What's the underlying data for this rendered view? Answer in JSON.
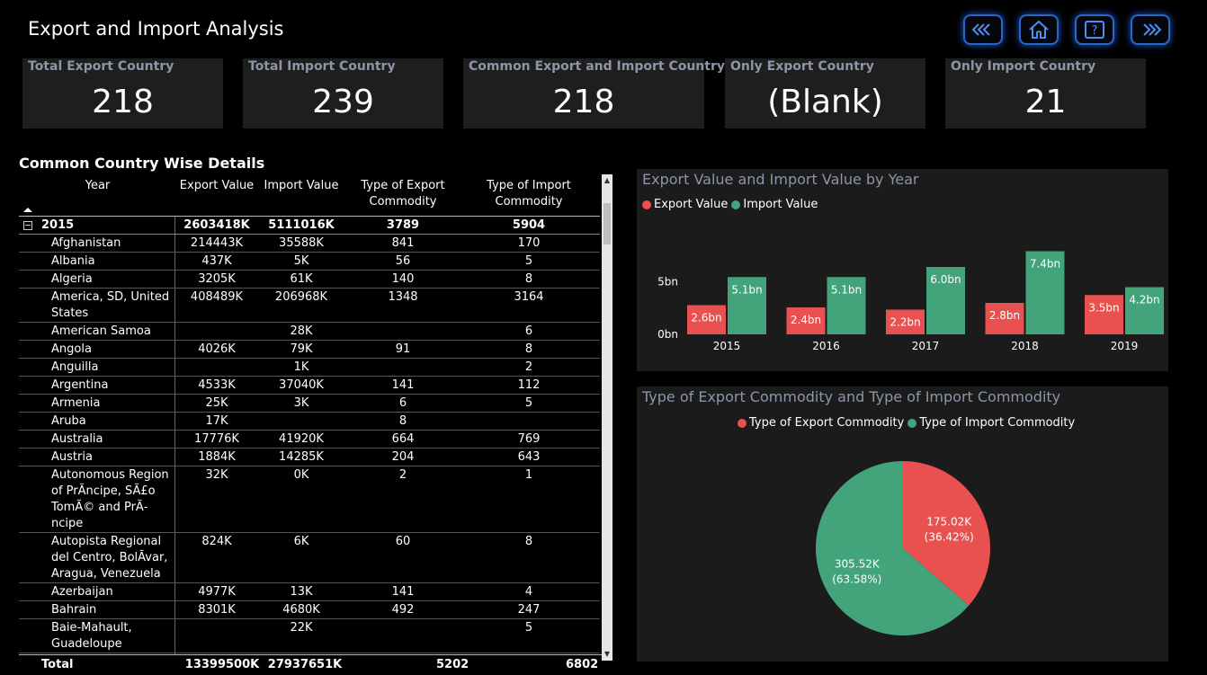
{
  "header": {
    "title": "Export and Import Analysis"
  },
  "nav": {
    "back_icon": "double-chevron-left-icon",
    "home_icon": "home-icon",
    "help_label": "?",
    "next_icon": "double-chevron-right-icon"
  },
  "kpis": [
    {
      "label": "Total Export Country",
      "value": "218"
    },
    {
      "label": "Total Import Country",
      "value": "239"
    },
    {
      "label": "Common Export and Import Country",
      "value": "218"
    },
    {
      "label": "Only Export Country",
      "value": "(Blank)"
    },
    {
      "label": "Only Import Country",
      "value": "21"
    }
  ],
  "table": {
    "title": "Common Country Wise Details",
    "columns": [
      "Year",
      "Export Value",
      "Import Value",
      "Type of Export Commodity",
      "Type of Import Commodity"
    ],
    "group": {
      "year": "2015",
      "export": "2603418K",
      "import": "5111016K",
      "type_export": "3789",
      "type_import": "5904"
    },
    "rows": [
      {
        "name": "Afghanistan",
        "export": "214443K",
        "import": "35588K",
        "type_export": "841",
        "type_import": "170"
      },
      {
        "name": "Albania",
        "export": "437K",
        "import": "5K",
        "type_export": "56",
        "type_import": "5"
      },
      {
        "name": "Algeria",
        "export": "3205K",
        "import": "61K",
        "type_export": "140",
        "type_import": "8"
      },
      {
        "name": "America, SD, United States",
        "export": "408489K",
        "import": "206968K",
        "type_export": "1348",
        "type_import": "3164"
      },
      {
        "name": "American Samoa",
        "export": "",
        "import": "28K",
        "type_export": "",
        "type_import": "6"
      },
      {
        "name": "Angola",
        "export": "4026K",
        "import": "79K",
        "type_export": "91",
        "type_import": "8"
      },
      {
        "name": "Anguilla",
        "export": "",
        "import": "1K",
        "type_export": "",
        "type_import": "2"
      },
      {
        "name": "Argentina",
        "export": "4533K",
        "import": "37040K",
        "type_export": "141",
        "type_import": "112"
      },
      {
        "name": "Armenia",
        "export": "25K",
        "import": "3K",
        "type_export": "6",
        "type_import": "5"
      },
      {
        "name": "Aruba",
        "export": "17K",
        "import": "",
        "type_export": "8",
        "type_import": ""
      },
      {
        "name": "Australia",
        "export": "17776K",
        "import": "41920K",
        "type_export": "664",
        "type_import": "769"
      },
      {
        "name": "Austria",
        "export": "1884K",
        "import": "14285K",
        "type_export": "204",
        "type_import": "643"
      },
      {
        "name": "Autonomous Region of PrÃncipe, SÃ£o TomÃ© and PrÃ­ncipe",
        "export": "32K",
        "import": "0K",
        "type_export": "2",
        "type_import": "1"
      },
      {
        "name": "Autopista Regional del Centro, BolÃvar, Aragua, Venezuela",
        "export": "824K",
        "import": "6K",
        "type_export": "60",
        "type_import": "8"
      },
      {
        "name": "Azerbaijan",
        "export": "4977K",
        "import": "13K",
        "type_export": "141",
        "type_import": "4"
      },
      {
        "name": "Bahrain",
        "export": "8301K",
        "import": "4680K",
        "type_export": "492",
        "type_import": "247"
      },
      {
        "name": "Baie-Mahault, Guadeloupe",
        "export": "",
        "import": "22K",
        "type_export": "",
        "type_import": "5"
      }
    ],
    "total": {
      "label": "Total",
      "export": "13399500K",
      "import": "27937651K",
      "type_export": "5202",
      "type_import": "6802"
    }
  },
  "bar_card": {
    "title": "Export Value and Import Value by Year"
  },
  "pie_card": {
    "title": "Type of Export Commodity and Type of Import Commodity"
  },
  "colors": {
    "export": "#e8514f",
    "import": "#43a37b",
    "nav_border": "#2a66c9"
  },
  "chart_data": [
    {
      "type": "bar",
      "title": "Export Value and Import Value by Year",
      "categories": [
        "2015",
        "2016",
        "2017",
        "2018",
        "2019"
      ],
      "series": [
        {
          "name": "Export Value",
          "values": [
            2.6,
            2.4,
            2.2,
            2.8,
            3.5
          ],
          "labels": [
            "2.6bn",
            "2.4bn",
            "2.2bn",
            "2.8bn",
            "3.5bn"
          ]
        },
        {
          "name": "Import Value",
          "values": [
            5.1,
            5.1,
            6.0,
            7.4,
            4.2
          ],
          "labels": [
            "5.1bn",
            "5.1bn",
            "6.0bn",
            "7.4bn",
            "4.2bn"
          ]
        }
      ],
      "yticks": [
        "0bn",
        "5bn"
      ],
      "ylim": [
        0,
        8
      ],
      "grid": false,
      "legend": "top-left"
    },
    {
      "type": "pie",
      "title": "Type of Export Commodity and Type of Import Commodity",
      "slices": [
        {
          "name": "Type of Export Commodity",
          "value": 175.02,
          "label": "175.02K",
          "pct": "(36.42%)"
        },
        {
          "name": "Type of Import Commodity",
          "value": 305.52,
          "label": "305.52K",
          "pct": "(63.58%)"
        }
      ],
      "legend": "top-center"
    }
  ]
}
